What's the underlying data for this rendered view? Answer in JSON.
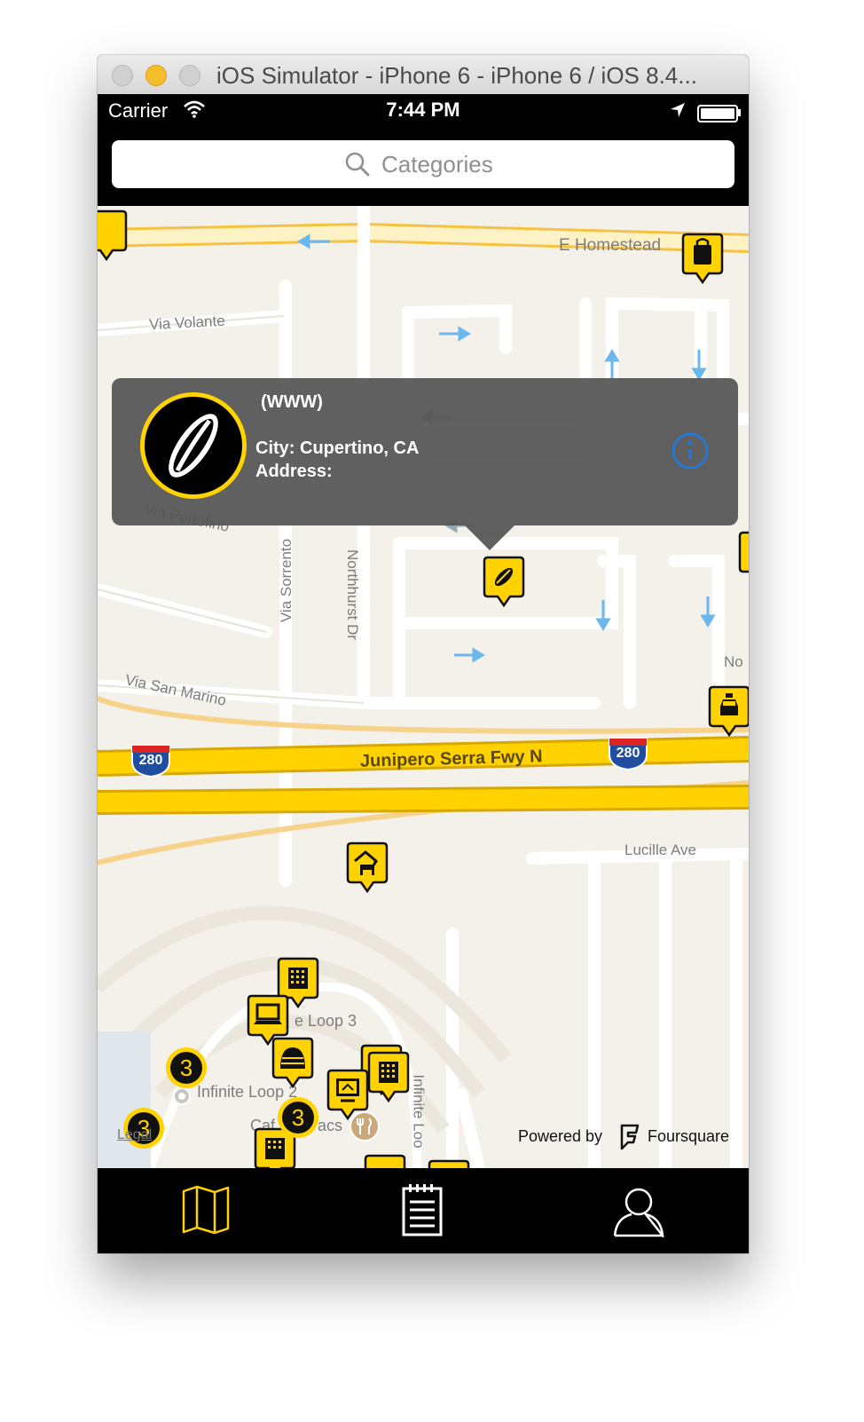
{
  "window": {
    "title": "iOS Simulator - iPhone 6 - iPhone 6 / iOS 8.4..."
  },
  "status_bar": {
    "carrier": "Carrier",
    "time": "7:44 PM"
  },
  "search": {
    "placeholder": "Categories"
  },
  "map": {
    "street_labels": {
      "e_homestead": "E Homestead",
      "via_volante": "Via Volante",
      "via_portofino": "Via Portofino",
      "via_sorrento": "Via Sorrento",
      "northhurst_dr": "Northhurst Dr",
      "via_san_marino": "Via San Marino",
      "junipero_serra": "Junipero Serra Fwy N",
      "lucille_ave": "Lucille Ave",
      "no_partial": "No",
      "loop3": "e Loop 3",
      "loop2": "Infinite Loop 2",
      "infinite_loop_v": "Infinite Loo",
      "caf": "Caf",
      "acs": "acs"
    },
    "highway_shields": [
      "280",
      "280"
    ],
    "clusters": [
      "3",
      "3",
      "3"
    ],
    "legal": "Legal",
    "attribution": {
      "powered_by": "Powered by",
      "brand": "Foursquare"
    }
  },
  "callout": {
    "title": "(WWW)",
    "city": "City: Cupertino, CA",
    "address": "Address:"
  },
  "tab_bar": {
    "items": [
      "map-icon",
      "list-icon",
      "profile-icon"
    ],
    "active_color": "#ffd200"
  },
  "colors": {
    "accent": "#ffd200",
    "freeway": "#ffd200",
    "callout_bg": "#555555"
  }
}
